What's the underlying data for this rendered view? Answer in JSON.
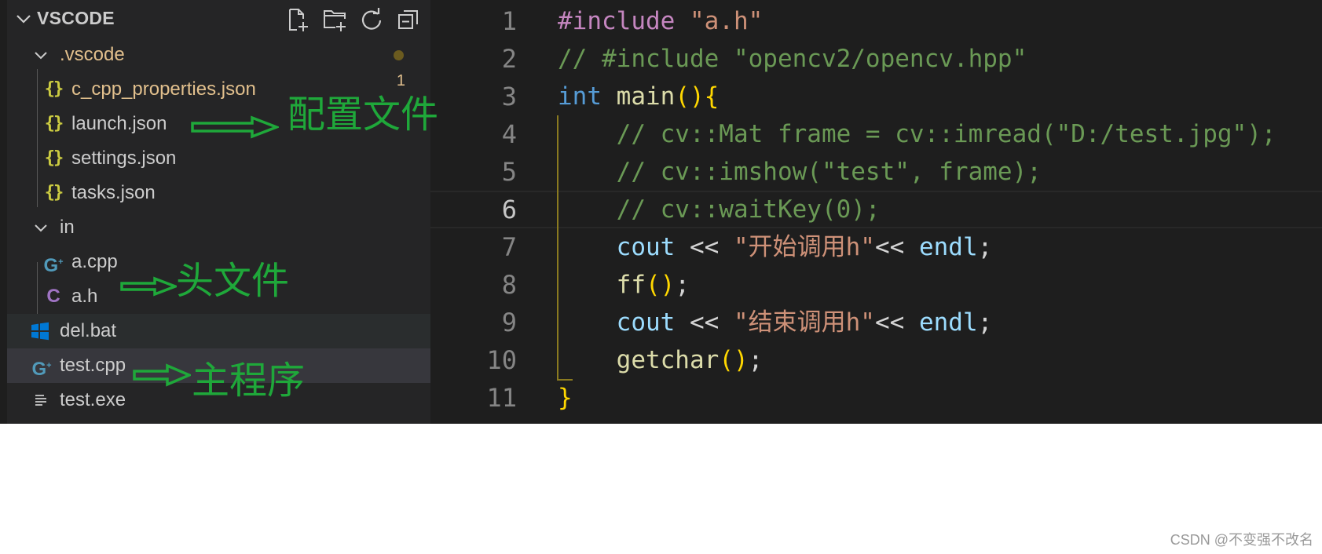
{
  "explorer": {
    "title": "VSCODE",
    "actions": [
      "new-file-icon",
      "new-folder-icon",
      "refresh-icon",
      "collapse-all-icon"
    ],
    "items": [
      {
        "label": ".vscode",
        "kind": "folder",
        "expanded": true,
        "modified": true
      },
      {
        "label": "c_cpp_properties.json",
        "kind": "json",
        "modified": true,
        "badge": "1"
      },
      {
        "label": "launch.json",
        "kind": "json"
      },
      {
        "label": "settings.json",
        "kind": "json"
      },
      {
        "label": "tasks.json",
        "kind": "json"
      },
      {
        "label": "in",
        "kind": "folder",
        "expanded": true
      },
      {
        "label": "a.cpp",
        "kind": "cpp"
      },
      {
        "label": "a.h",
        "kind": "header"
      },
      {
        "label": "del.bat",
        "kind": "bat"
      },
      {
        "label": "test.cpp",
        "kind": "cpp",
        "selected": true
      },
      {
        "label": "test.exe",
        "kind": "exe"
      }
    ]
  },
  "editor": {
    "current_line": 6,
    "lines": [
      {
        "n": "1",
        "text": "#include \"a.h\""
      },
      {
        "n": "2",
        "text": "// #include \"opencv2/opencv.hpp\""
      },
      {
        "n": "3",
        "text": "int main(){"
      },
      {
        "n": "4",
        "text": "    // cv::Mat frame = cv::imread(\"D:/test.jpg\");"
      },
      {
        "n": "5",
        "text": "    // cv::imshow(\"test\", frame);"
      },
      {
        "n": "6",
        "text": "    // cv::waitKey(0);"
      },
      {
        "n": "7",
        "text": "    cout << \"开始调用h\"<< endl;"
      },
      {
        "n": "8",
        "text": "    ff();"
      },
      {
        "n": "9",
        "text": "    cout << \"结束调用h\"<< endl;"
      },
      {
        "n": "10",
        "text": "    getchar();"
      },
      {
        "n": "11",
        "text": "}"
      }
    ]
  },
  "annotations": {
    "config": "配置文件",
    "header": "头文件",
    "main": "主程序"
  },
  "watermark": "CSDN @不变强不改名",
  "colors": {
    "annotation": "#1fa83a",
    "sidebar_bg": "#252526",
    "editor_bg": "#1e1e1e",
    "json_icon": "#cbcb41",
    "cpp_icon": "#519aba",
    "header_icon": "#a074c4",
    "modified_text": "#e2c08d"
  }
}
